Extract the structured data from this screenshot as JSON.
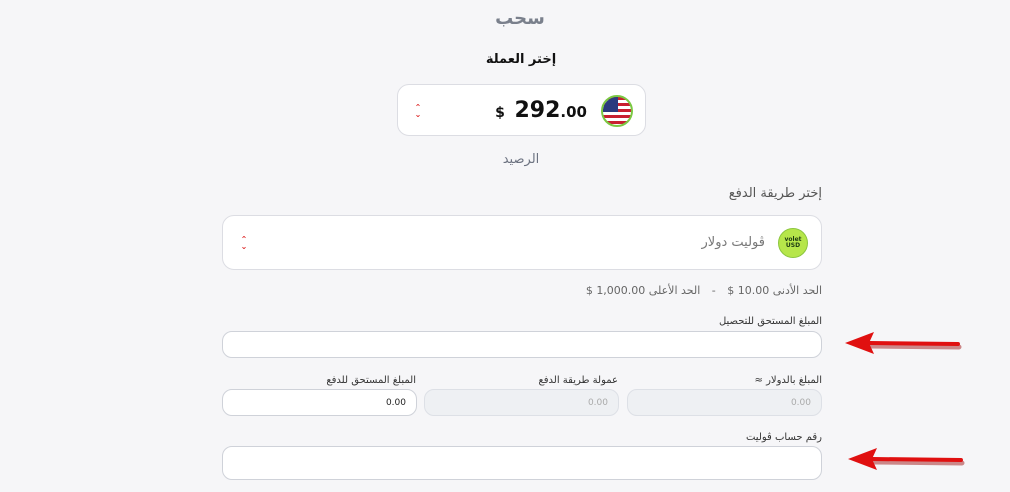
{
  "header": {
    "title": "سحب"
  },
  "currency": {
    "label": "إختر العملة",
    "balance_int": "292",
    "balance_dec": ".00",
    "currency_symbol": "$",
    "flag_icon": "us-flag-icon"
  },
  "balance_label": "الرصيد",
  "payment_method": {
    "label": "إختر طريقة الدفع",
    "selected": "ڤوليت دولار",
    "logo_top": "volet",
    "logo_bottom": "USD"
  },
  "limits": {
    "min_text": "الحد الأدنى 10.00 $",
    "separator": "-",
    "max_text": "الحد الأعلى 1,000.00 $"
  },
  "fields": {
    "amount_due_label": "المبلغ المستحق للتحصيل",
    "usd_amount_label": "المبلغ بالدولار ≈",
    "usd_amount_value": "0.00",
    "fee_label": "عمولة طريقة الدفع",
    "fee_value": "0.00",
    "pay_amount_label": "المبلغ المستحق للدفع",
    "pay_amount_value": "0.00",
    "account_label": "رقم حساب ڤوليت"
  },
  "colors": {
    "arrow": "#e01010",
    "accent_green": "#8cc63f"
  }
}
